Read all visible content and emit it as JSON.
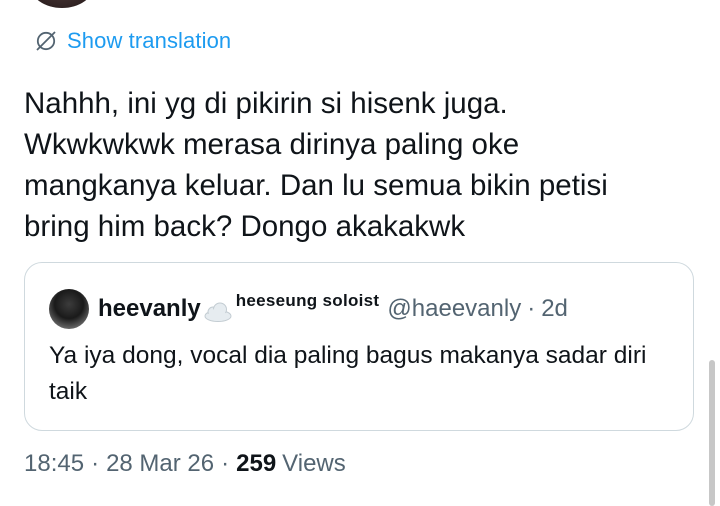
{
  "translation": {
    "label": "Show translation"
  },
  "tweet": {
    "text": "Nahhh, ini yg di pikirin si hisenk juga.\nWkwkwkwk merasa dirinya paling oke\nmangkanya keluar. Dan lu semua bikin petisi\nbring him back? Dongo akakakwk"
  },
  "quote": {
    "display_name": "heevanly",
    "name_suffix": "heeseung soloist",
    "handle": "@haeevanly",
    "separator": "·",
    "time": "2d",
    "text": "Ya iya dong, vocal dia paling bagus makanya sadar diri taik"
  },
  "meta": {
    "time": "18:45",
    "date": "28 Mar 26",
    "separator": "·",
    "views_count": "259",
    "views_label": "Views"
  },
  "colors": {
    "link": "#1d9bf0",
    "secondary_text": "#536471",
    "primary_text": "#0f1419",
    "border": "#cfd9de"
  },
  "icons": {
    "translate": "globe-icon",
    "name_emoji": "cloud-icon"
  }
}
